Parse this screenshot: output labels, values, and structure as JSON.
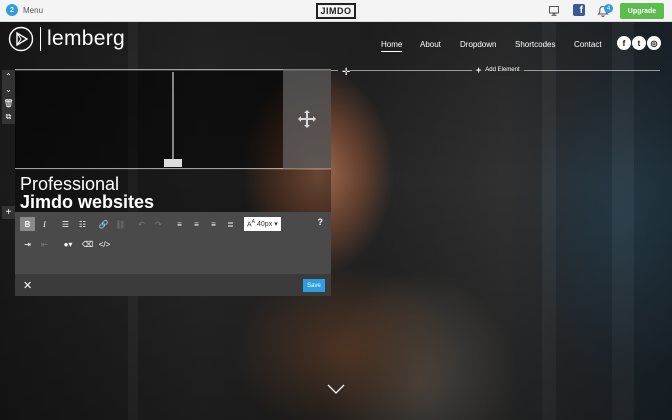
{
  "topbar": {
    "menu_badge": "2",
    "menu_label": "Menu",
    "logo_text": "JIMDO",
    "notifications_count": "4",
    "upgrade_label": "Upgrade",
    "facebook_glyph": "f"
  },
  "site": {
    "brand_name": "lemberg",
    "nav": [
      {
        "label": "Home",
        "active": true
      },
      {
        "label": "About"
      },
      {
        "label": "Dropdown"
      },
      {
        "label": "Shortcodes"
      },
      {
        "label": "Contact"
      }
    ],
    "social": [
      {
        "icon": "facebook-icon",
        "glyph": "f"
      },
      {
        "icon": "twitter-icon",
        "glyph": "t"
      },
      {
        "icon": "instagram-icon",
        "glyph": "◎"
      }
    ]
  },
  "editing": {
    "add_element_label": "Add Element",
    "heading_line1": "Professional",
    "heading_line2": "Jimdo websites",
    "font_size": "40px",
    "help_label": "?",
    "save_label": "Save",
    "close_label": "✕"
  },
  "colors": {
    "accent": "#2d9de0",
    "upgrade": "#5bbd4c",
    "facebook": "#3b5998"
  }
}
